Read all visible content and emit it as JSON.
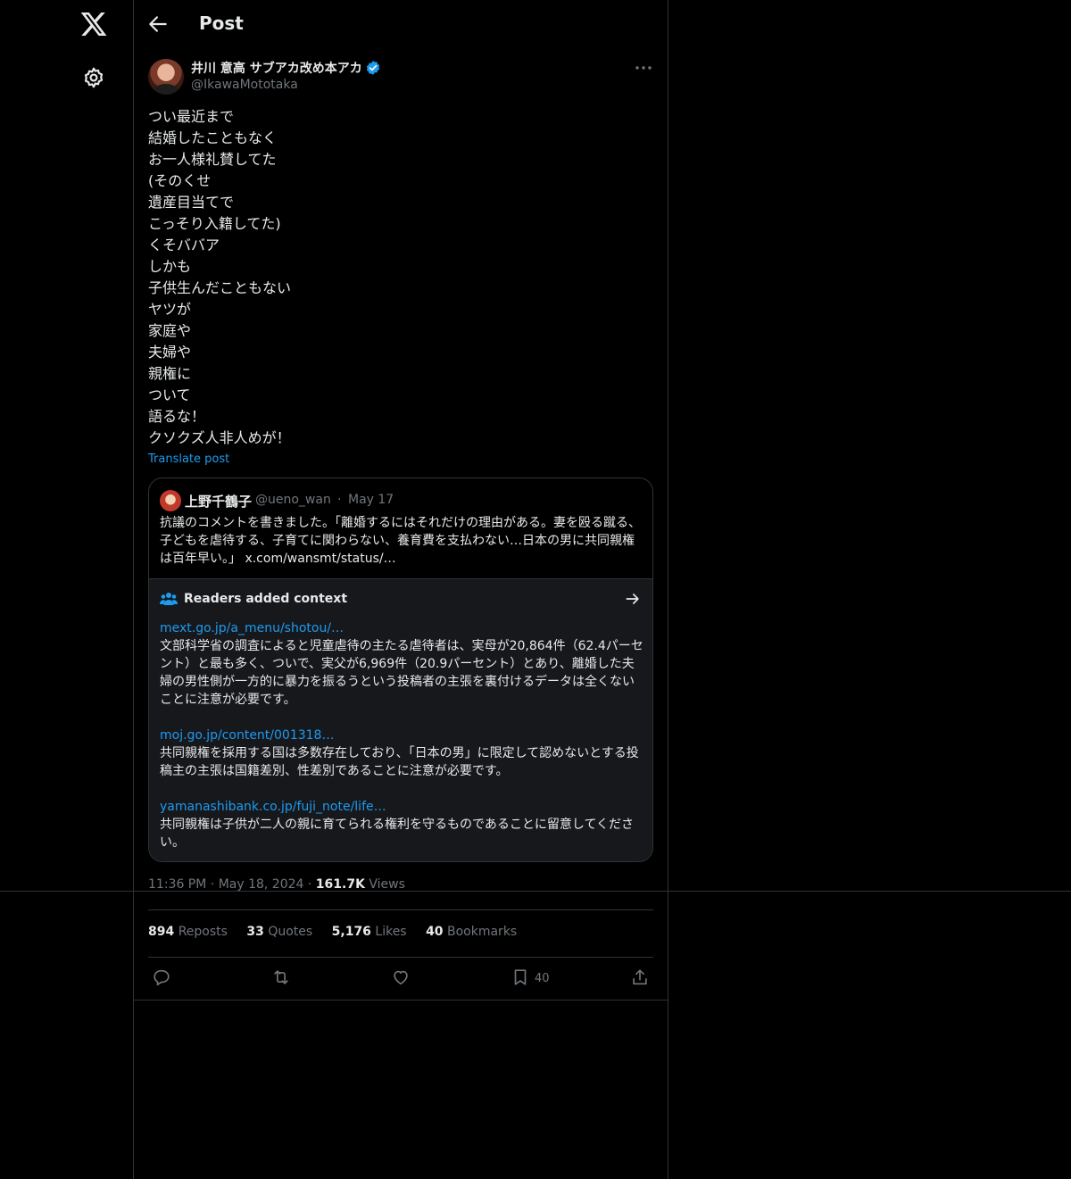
{
  "header": {
    "title": "Post"
  },
  "post": {
    "author_name": "井川 意高 サブアカ改め本アカ",
    "author_handle": "@IkawaMototaka",
    "lines": [
      "つい最近まで",
      "結婚したこともなく",
      "お一人様礼賛してた",
      "(そのくせ",
      "遺産目当てで",
      "こっそり入籍してた)",
      "くそババア",
      "しかも",
      "子供生んだこともない",
      "ヤツが",
      "家庭や",
      "夫婦や",
      "親権に",
      "ついて",
      "語るな！",
      "クソクズ人非人めが！"
    ],
    "translate_label": "Translate post"
  },
  "quote": {
    "name": "上野千鶴子",
    "handle": "@ueno_wan",
    "dot": "·",
    "date": "May 17",
    "text": "抗議のコメントを書きました。「離婚するにはそれだけの理由がある。妻を殴る蹴る、子どもを虐待する、子育てに関わらない、養育費を支払わない…日本の男に共同親権は百年早い。」 x.com/wansmt/status/…"
  },
  "context": {
    "title": "Readers added context",
    "notes": [
      {
        "link": "mext.go.jp/a_menu/shotou/…",
        "text": "文部科学省の調査によると児童虐待の主たる虐待者は、実母が20,864件（62.4パーセント）と最も多く、ついで、実父が6,969件（20.9パーセント）とあり、離婚した夫婦の男性側が一方的に暴力を振るうという投稿者の主張を裏付けるデータは全くないことに注意が必要です。"
      },
      {
        "link": "moj.go.jp/content/001318…",
        "text": "共同親権を採用する国は多数存在しており、「日本の男」に限定して認めないとする投稿主の主張は国籍差別、性差別であることに注意が必要です。"
      },
      {
        "link": "yamanashibank.co.jp/fuji_note/life…",
        "text": "共同親権は子供が二人の親に育てられる権利を守るものであることに留意してください。"
      }
    ]
  },
  "meta": {
    "time": "11:36 PM",
    "sep1": "·",
    "date": "May 18, 2024",
    "sep2": "·",
    "views_num": "161.7K",
    "views_label": "Views"
  },
  "stats": {
    "reposts_num": "894",
    "reposts_label": "Reposts",
    "quotes_num": "33",
    "quotes_label": "Quotes",
    "likes_num": "5,176",
    "likes_label": "Likes",
    "bookmarks_num": "40",
    "bookmarks_label": "Bookmarks"
  },
  "actions": {
    "bookmark_count": "40"
  },
  "icons": [
    "x-logo-icon",
    "gear-icon",
    "back-arrow-icon",
    "verified-badge-icon",
    "more-icon",
    "readers-context-icon",
    "arrow-right-icon",
    "reply-icon",
    "repost-icon",
    "like-icon",
    "bookmark-icon",
    "share-icon"
  ],
  "colors": {
    "background": "#000000",
    "text": "#e7e9ea",
    "muted": "#71767b",
    "accent": "#1d9bf0",
    "border": "#2f3336",
    "context_bg": "#16181c"
  }
}
